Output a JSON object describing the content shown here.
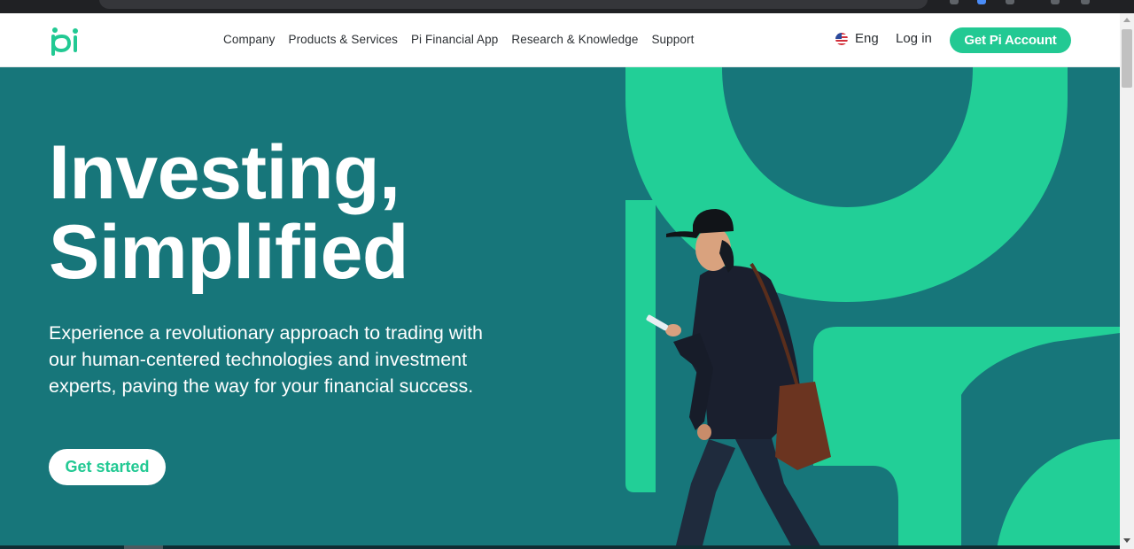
{
  "brand": {
    "logo_text": "pi",
    "accent_color": "#22c993",
    "hero_color": "#17767a"
  },
  "header": {
    "nav": [
      "Company",
      "Products & Services",
      "Pi Financial App",
      "Research & Knowledge",
      "Support"
    ],
    "language": {
      "label": "Eng",
      "flag_icon": "us-flag-icon"
    },
    "login_label": "Log in",
    "cta_label": "Get Pi Account"
  },
  "hero": {
    "headline": [
      "Investing,",
      "Simplified"
    ],
    "subtext": "Experience a revolutionary approach to trading with our human-centered technologies and investment experts, paving the way for your financial success.",
    "cta_label": "Get started",
    "image": "man-walking-with-phone-illustration"
  }
}
